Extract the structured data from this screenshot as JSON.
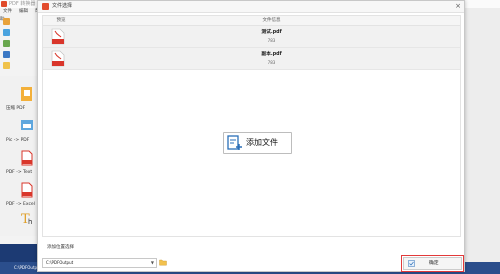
{
  "background_app": {
    "title": "PDF 转换器",
    "menu": [
      "文件",
      "编辑",
      "帮助"
    ],
    "toolbar_items": [
      "",
      "",
      "",
      "",
      "",
      ""
    ],
    "sidebar_items": [
      {
        "label": "压缩 PDF",
        "icon": "compress-pdf-icon"
      },
      {
        "label": "Pic -> PDF",
        "icon": "pic-to-pdf-icon"
      },
      {
        "label": "PDF -> Text",
        "icon": "pdf-to-text-icon"
      },
      {
        "label": "PDF -> Excel",
        "icon": "pdf-to-excel-icon"
      },
      {
        "label": "",
        "icon": "font-icon"
      }
    ],
    "status_text": "C:\\PDFOutput"
  },
  "dialog": {
    "title": "文件选择",
    "close_label": "×",
    "list": {
      "header_preview": "预览",
      "header_name": "文件信息",
      "files": [
        {
          "name": "测试.pdf",
          "size": "783",
          "icon": "pdf-file-icon"
        },
        {
          "name": "副本.pdf",
          "size": "783",
          "icon": "pdf-file-icon"
        }
      ]
    },
    "add_file_button": "添加文件",
    "output_label": "添加位置选择",
    "output_path": "C:\\PDFOutput",
    "confirm_button": "确定"
  },
  "colors": {
    "accent": "#e23a3a",
    "pdf_red": "#d9362b",
    "status_blue": "#2b4e8c",
    "add_icon_blue": "#2a6fb8"
  }
}
